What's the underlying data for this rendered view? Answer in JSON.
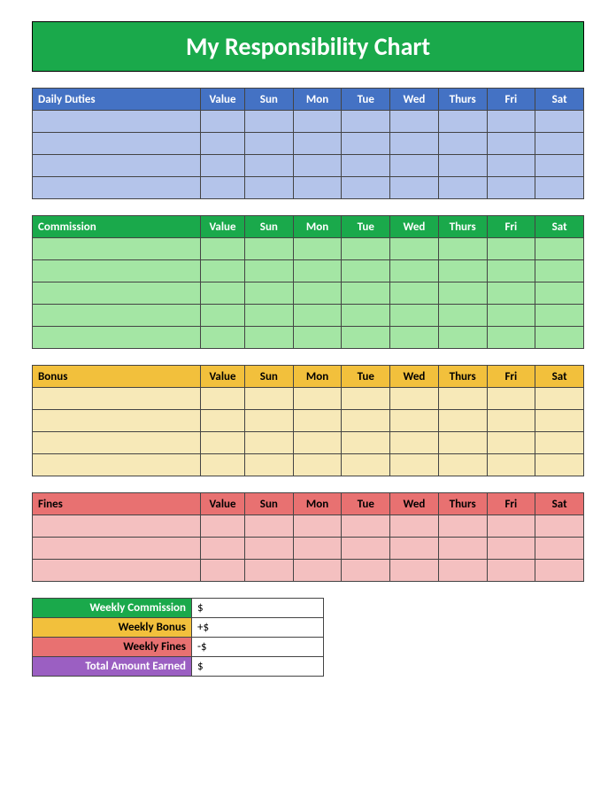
{
  "title": "My Responsibility Chart",
  "columns": [
    "Value",
    "Sun",
    "Mon",
    "Tue",
    "Wed",
    "Thurs",
    "Fri",
    "Sat"
  ],
  "sections": {
    "daily": {
      "label": "Daily Duties",
      "rows": 4
    },
    "commission": {
      "label": "Commission",
      "rows": 5
    },
    "bonus": {
      "label": "Bonus",
      "rows": 4
    },
    "fines": {
      "label": "Fines",
      "rows": 3
    }
  },
  "summary": {
    "commission": {
      "label": "Weekly Commission",
      "value": "$"
    },
    "bonus": {
      "label": "Weekly Bonus",
      "value": "+$"
    },
    "fines": {
      "label": "Weekly Fines",
      "value": "-$"
    },
    "total": {
      "label": "Total Amount Earned",
      "value": "$"
    }
  }
}
